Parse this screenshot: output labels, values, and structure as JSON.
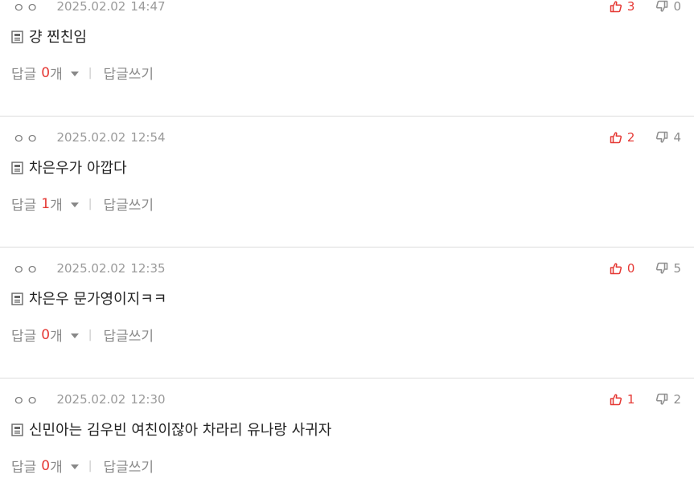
{
  "comments": [
    {
      "author": "ㅇㅇ",
      "date": "2025.02.02",
      "time": "14:47",
      "up": "3",
      "down": "0",
      "text": "걍 찐친임",
      "reply_label": "답글",
      "reply_count": "0",
      "reply_unit": "개",
      "write_label": "답글쓰기"
    },
    {
      "author": "ㅇㅇ",
      "date": "2025.02.02",
      "time": "12:54",
      "up": "2",
      "down": "4",
      "text": "차은우가 아깝다",
      "reply_label": "답글",
      "reply_count": "1",
      "reply_unit": "개",
      "write_label": "답글쓰기"
    },
    {
      "author": "ㅇㅇ",
      "date": "2025.02.02",
      "time": "12:35",
      "up": "0",
      "down": "5",
      "text": "차은우 문가영이지ㅋㅋ",
      "reply_label": "답글",
      "reply_count": "0",
      "reply_unit": "개",
      "write_label": "답글쓰기"
    },
    {
      "author": "ㅇㅇ",
      "date": "2025.02.02",
      "time": "12:30",
      "up": "1",
      "down": "2",
      "text": "신민아는 김우빈 여친이잖아 차라리 유나랑 사귀자",
      "reply_label": "답글",
      "reply_count": "0",
      "reply_unit": "개",
      "write_label": "답글쓰기"
    }
  ],
  "separator": "|",
  "colors": {
    "accent_red": "#e53935",
    "muted_gray": "#8a8a8a",
    "divider": "#dcdcdc"
  },
  "icons": {
    "vote_up": "thumbs-up-outline-icon",
    "vote_down": "thumbs-down-outline-icon",
    "content": "document-icon",
    "reply_toggle": "caret-down-icon"
  }
}
